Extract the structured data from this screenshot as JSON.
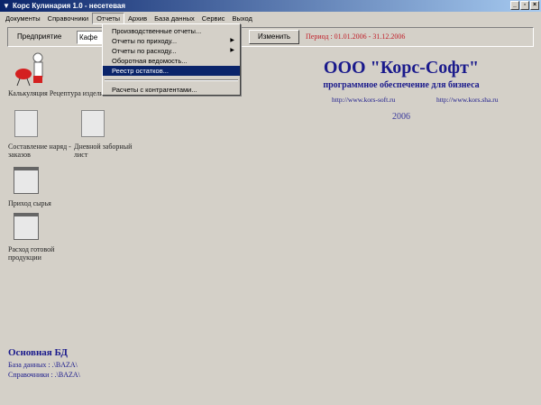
{
  "window": {
    "title": "Корс Кулинария 1.0 - несетевая",
    "buttons": [
      "_",
      "▫",
      "×"
    ]
  },
  "menu": [
    "Документы",
    "Справочники",
    "Отчеты",
    "Архив",
    "База данных",
    "Сервис",
    "Выход"
  ],
  "toolbar": {
    "label": "Предприятие",
    "combo_value": "Кафе",
    "change_button": "Изменить",
    "period": "Период : 01.01.2006 - 31.12.2006"
  },
  "reports_menu": {
    "items": [
      "Производственные отчеты...",
      "Отчеты по приходу...",
      "Отчеты по расходу...",
      "Оборотная ведомость...",
      "Реестр остатков...",
      "Расчеты с контрагентами..."
    ],
    "selected": "Реестр остатков..."
  },
  "desktop": {
    "icons": [
      "Калькуляция Рецептура изделий",
      "Составление наряд - заказов",
      "Дневной заборный лист",
      "Приход сырья",
      "Расход готовой продукции"
    ]
  },
  "brand": {
    "company": "ООО \"Корс-Софт\"",
    "tagline": "программное обеспечение для бизнеса",
    "link1": "http://www.kors-soft.ru",
    "link2": "http://www.kors.sha.ru",
    "year": "2006"
  },
  "db": {
    "title": "Основная БД",
    "database": "База данных : .\\BAZA\\",
    "directories": "Справочники : .\\BAZA\\"
  }
}
